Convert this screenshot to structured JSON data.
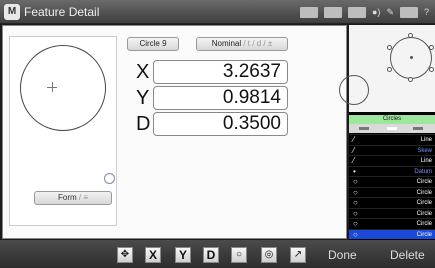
{
  "window": {
    "logo_text": "M",
    "title": "Feature Detail"
  },
  "title_icons": {
    "battery_label": ""
  },
  "form_panel": {
    "button_label": "Form",
    "button_suffix": "/ ≡"
  },
  "feature": {
    "name_button": "Circle 9",
    "nominal_button": "Nominal",
    "nominal_suffix": "/ t / d / ±"
  },
  "measurements": [
    {
      "axis": "X",
      "value": "3.2637"
    },
    {
      "axis": "Y",
      "value": "0.9814"
    },
    {
      "axis": "D",
      "value": "0.3500"
    }
  ],
  "feature_list": {
    "header": "Circles",
    "rows": [
      {
        "icon": "line-icon",
        "glyph": "⁄",
        "label": "Line",
        "style": "normal"
      },
      {
        "icon": "line-icon",
        "glyph": "⁄",
        "label": "Skew",
        "style": "blue"
      },
      {
        "icon": "line-icon",
        "glyph": "⁄",
        "label": "Line",
        "style": "normal"
      },
      {
        "icon": "point-icon",
        "glyph": "•",
        "label": "Datum",
        "style": "blue"
      },
      {
        "icon": "circle-icon",
        "glyph": "○",
        "label": "Circle",
        "style": "normal"
      },
      {
        "icon": "circle-icon",
        "glyph": "○",
        "label": "Circle",
        "style": "normal"
      },
      {
        "icon": "circle-icon",
        "glyph": "○",
        "label": "Circle",
        "style": "normal"
      },
      {
        "icon": "circle-icon",
        "glyph": "○",
        "label": "Circle",
        "style": "normal"
      },
      {
        "icon": "circle-icon",
        "glyph": "○",
        "label": "Circle",
        "style": "normal"
      },
      {
        "icon": "circle-icon",
        "glyph": "○",
        "label": "Circle",
        "style": "selected"
      }
    ]
  },
  "toolbar": {
    "buttons": [
      {
        "name": "move-icon",
        "glyph": "✥"
      },
      {
        "name": "x-toggle",
        "glyph": "X"
      },
      {
        "name": "y-toggle",
        "glyph": "Y"
      },
      {
        "name": "d-toggle",
        "glyph": "D"
      },
      {
        "name": "circle-icon",
        "glyph": "○"
      },
      {
        "name": "concentric-icon",
        "glyph": "◎"
      },
      {
        "name": "arrow-icon",
        "glyph": "↗"
      }
    ],
    "done_label": "Done",
    "delete_label": "Delete"
  },
  "colors": {
    "selected_row": "#1c49d8",
    "list_header": "#9de79d",
    "highlight_text": "#7b8dff"
  }
}
